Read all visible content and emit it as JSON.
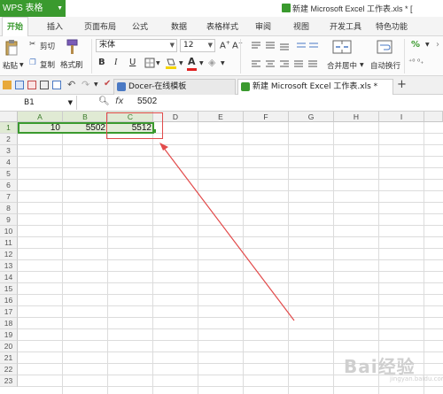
{
  "app": {
    "name": "WPS 表格",
    "window_title": "新建 Microsoft Excel 工作表.xls * [",
    "accent": "#3a9a2e"
  },
  "menu": [
    "开始",
    "插入",
    "页面布局",
    "公式",
    "数据",
    "表格样式",
    "审阅",
    "视图",
    "开发工具",
    "特色功能"
  ],
  "ribbon": {
    "paste": "粘贴",
    "cut": "剪切",
    "copy": "复制",
    "format_painter": "格式刷",
    "font_name": "宋体",
    "font_size": "12",
    "merge_center": "合并居中",
    "wrap_text": "自动换行",
    "bold": "B",
    "italic": "I",
    "underline": "U",
    "font_color_letter": "A",
    "font_color": "#e02020",
    "highlight_color": "#f5d400"
  },
  "tabs": {
    "docer": "Docer-在线模板",
    "workbook": "新建 Microsoft Excel 工作表.xls *",
    "add": "+"
  },
  "formula_bar": {
    "name_box": "B1",
    "fx_label": "fx",
    "value": "5502"
  },
  "columns": [
    "A",
    "B",
    "C",
    "D",
    "E",
    "F",
    "G",
    "H",
    "I"
  ],
  "rows": [
    "1",
    "2",
    "3",
    "4",
    "5",
    "6",
    "7",
    "8",
    "9",
    "10",
    "11",
    "12",
    "13",
    "14",
    "15",
    "16",
    "17",
    "18",
    "19",
    "20",
    "21",
    "22",
    "23"
  ],
  "cells": {
    "A1": "10",
    "B1": "5502",
    "C1": "5512"
  },
  "watermark": {
    "text": "Bai经验",
    "sub": "jingyan.baidu.com"
  },
  "annotation_color": "#e24b4b"
}
